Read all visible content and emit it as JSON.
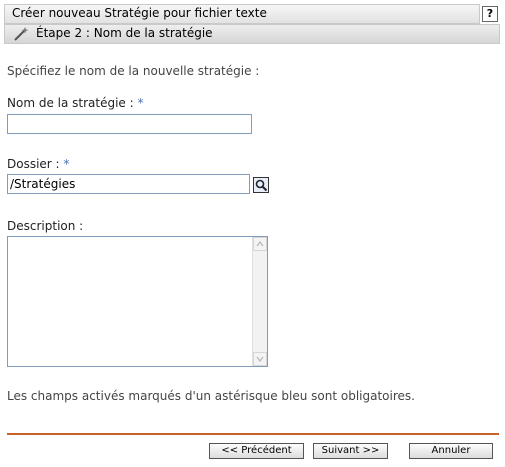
{
  "header": {
    "title": "Créer nouveau Stratégie pour fichier texte",
    "help_label": "?"
  },
  "step": {
    "title": "Étape 2 : Nom de la stratégie",
    "icon": "wizard-wand-icon"
  },
  "form": {
    "intro": "Spécifiez le nom de la nouvelle stratégie :",
    "required_marker": "*",
    "name": {
      "label": "Nom de la stratégie :",
      "value": ""
    },
    "folder": {
      "label": "Dossier :",
      "value": "/Stratégies",
      "browse_icon": "search-icon"
    },
    "description": {
      "label": "Description :",
      "value": ""
    },
    "footnote": "Les champs activés marqués d'un astérisque bleu sont obligatoires."
  },
  "buttons": {
    "back": "<< Précédent",
    "next": "Suivant >>",
    "cancel": "Annuler"
  },
  "colors": {
    "accent_rule": "#c8602a",
    "required_marker": "#4a6fb5",
    "field_border": "#7f9db9"
  }
}
